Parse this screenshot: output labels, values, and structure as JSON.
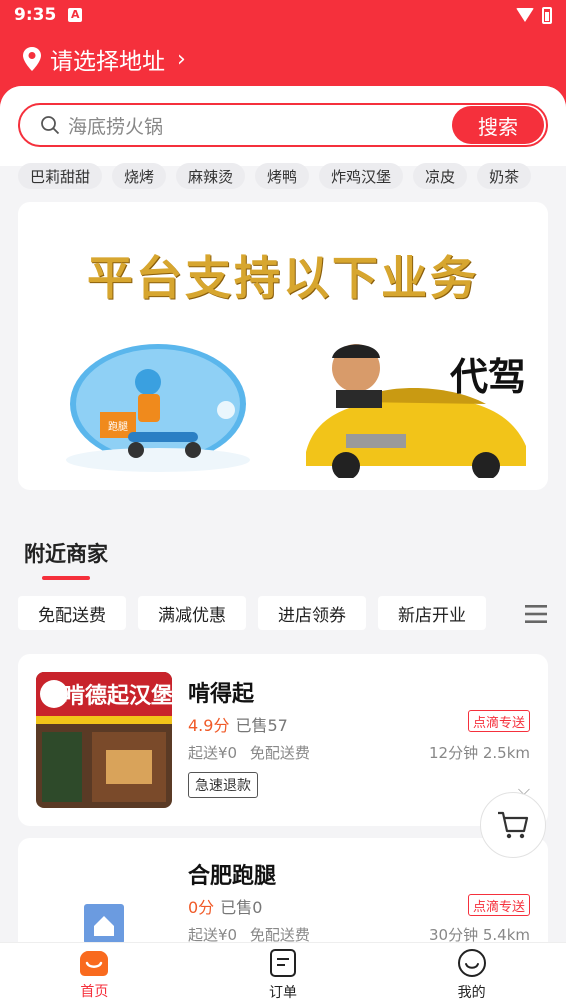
{
  "status_bar": {
    "time": "9:35",
    "a_badge": "A"
  },
  "header": {
    "address_label": "请选择地址",
    "bg_color": "#f5303c"
  },
  "search": {
    "placeholder": "海底捞火锅",
    "button_label": "搜索"
  },
  "chips": [
    "巴莉甜甜",
    "烧烤",
    "麻辣烫",
    "烤鸭",
    "炸鸡汉堡",
    "凉皮",
    "奶茶"
  ],
  "banner": {
    "headline": "平台支持以下业务",
    "driver_label": "代驾",
    "courier_box_text": "跑腿"
  },
  "nearby": {
    "title": "附近商家"
  },
  "filters": [
    "免配送费",
    "满减优惠",
    "进店领券",
    "新店开业"
  ],
  "merchants": [
    {
      "name": "啃得起",
      "rating": "4.9分",
      "sold": "已售57",
      "delivery_tag": "点滴专送",
      "min_order": "起送¥0",
      "free_delivery": "免配送费",
      "time_distance": "12分钟  2.5km",
      "badge": "急速退款",
      "sign_text": "啃德起汉堡"
    },
    {
      "name": "合肥跑腿",
      "rating": "0分",
      "sold": "已售0",
      "delivery_tag": "点滴专送",
      "min_order": "起送¥0",
      "free_delivery": "免配送费",
      "time_distance": "30分钟  5.4km"
    }
  ],
  "tabbar": [
    {
      "label": "首页",
      "icon": "home-icon",
      "active": true
    },
    {
      "label": "订单",
      "icon": "orders-icon",
      "active": false
    },
    {
      "label": "我的",
      "icon": "profile-icon",
      "active": false
    }
  ]
}
